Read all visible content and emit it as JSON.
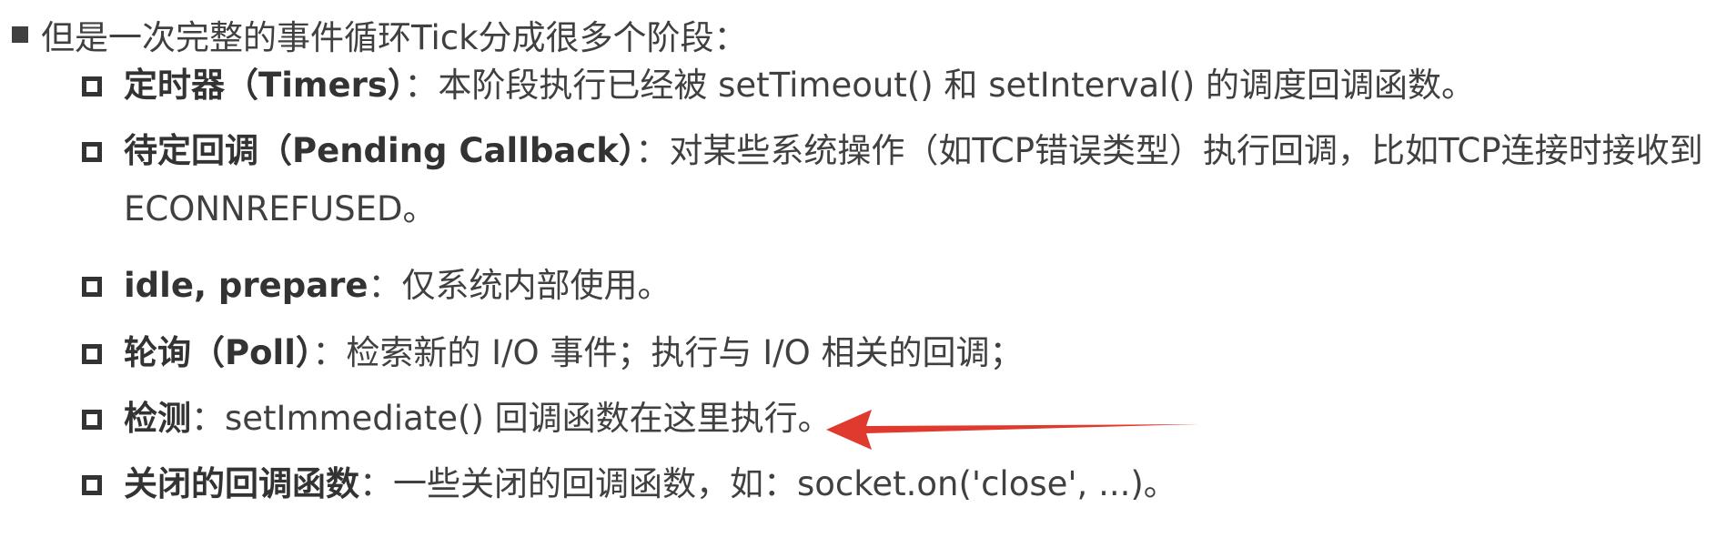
{
  "heading": {
    "text": "但是一次完整的事件循环Tick分成很多个阶段："
  },
  "phases": [
    {
      "term": "定时器（Timers）",
      "sep": "：",
      "desc": "本阶段执行已经被 setTimeout() 和 setInterval() 的调度回调函数。"
    },
    {
      "term": "待定回调（Pending Callback）",
      "sep": "：",
      "desc": "对某些系统操作（如TCP错误类型）执行回调，比如TCP连接时接收到",
      "desc_cont": "ECONNREFUSED。"
    },
    {
      "term": "idle, prepare",
      "sep": "：",
      "desc": "仅系统内部使用。"
    },
    {
      "term": "轮询（Poll）",
      "sep": "：",
      "desc": "检索新的 I/O 事件；执行与 I/O 相关的回调；"
    },
    {
      "term": "检测",
      "sep": "：",
      "desc": "setImmediate() 回调函数在这里执行。"
    },
    {
      "term": "关闭的回调函数",
      "sep": "：",
      "desc": "一些关闭的回调函数，如：socket.on('close', ...)。"
    }
  ],
  "colors": {
    "text": "#404040",
    "term": "#333333",
    "arrow": "#e03a2f"
  }
}
